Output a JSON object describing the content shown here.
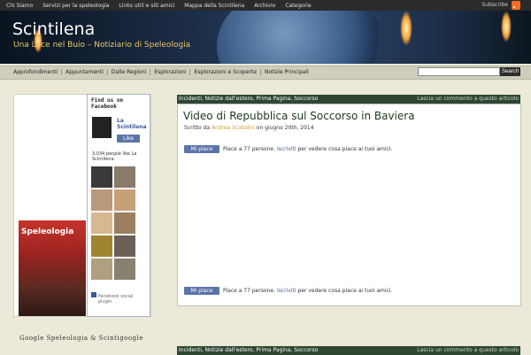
{
  "topnav": [
    "Chi Siamo",
    "Servizi per la speleologia",
    "Links utili e siti amici",
    "Mappa della Scintilena",
    "Archivio",
    "Categorie"
  ],
  "subscribe": "Subscribe",
  "site": {
    "title": "Scintilena",
    "tagline": "Una Luce nel Buio – Notiziario di Speleologia"
  },
  "mainnav": [
    "Approfondimenti",
    "Appuntamenti",
    "Dalle Regioni",
    "Esplorazioni",
    "Esplorazioni e Scoperte",
    "Notizie Principali"
  ],
  "search": {
    "value": "",
    "button": "Search"
  },
  "facebook": {
    "heading_line1": "Find us on",
    "heading_line2": "Facebook",
    "page_name_line1": "La",
    "page_name_line2": "Scintilena",
    "like": "Like",
    "count_line1": "3,034 people like La",
    "count_line2": "Scintilena.",
    "plugin_line1": "Facebook social",
    "plugin_line2": "plugin"
  },
  "magazine": {
    "title": "Speleologia"
  },
  "widget2_title": "Google Speleologia & Scintigoogle",
  "post": {
    "categories": "Incidenti, Notizie dall'estero, Prima Pagina, Soccorso",
    "comment": "Lascia un commento a questo articolo",
    "title": "Video di Repubblica sul Soccorso in Baviera",
    "meta_prefix": "Scritto da",
    "author": "Andrea Scatolini",
    "meta_date": "on giugno 20th, 2014",
    "like_button": "Mi piace",
    "like_text_prefix": "Piace a 77 persone.",
    "like_signup": "Iscriviti",
    "like_text_suffix": "per vedere cosa piace ai tuoi amici."
  },
  "post2": {
    "categories": "Incidenti, Notizie dall'estero, Prima Pagina, Soccorso",
    "comment": "Lascia un commento a questo articolo"
  },
  "colors": {
    "topbar": "#2b2b2b",
    "navbar": "#cfcdbd",
    "post_bar": "#2e4733",
    "accent": "#c8a032",
    "facebook": "#3b5998"
  }
}
